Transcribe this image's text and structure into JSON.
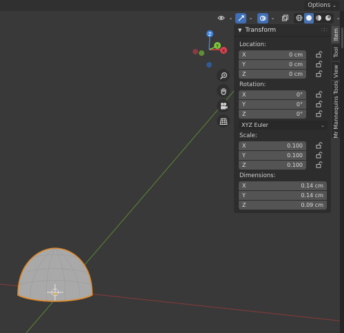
{
  "header": {
    "options_label": "Options",
    "tools": [
      {
        "icon": "visibility-icon"
      },
      {
        "icon": "gizmo-toggle-icon"
      },
      {
        "icon": "overlays-icon"
      },
      {
        "icon": "xray-icon"
      }
    ],
    "shading_modes": [
      {
        "icon": "wireframe-shading-icon",
        "active": false
      },
      {
        "icon": "solid-shading-icon",
        "active": true
      },
      {
        "icon": "material-shading-icon",
        "active": false
      },
      {
        "icon": "rendered-shading-icon",
        "active": false
      }
    ]
  },
  "gizmo": {
    "x": "X",
    "y": "Y",
    "z": "Z",
    "colors": {
      "x": "#e2414f",
      "y": "#80c83b",
      "z": "#3d84e0"
    }
  },
  "nav_buttons": [
    {
      "icon": "zoom-icon"
    },
    {
      "icon": "pan-hand-icon"
    },
    {
      "icon": "camera-view-icon"
    },
    {
      "icon": "ortho-grid-icon"
    }
  ],
  "transform_panel": {
    "title": "Transform",
    "location": {
      "label": "Location:",
      "rows": [
        {
          "axis": "X",
          "value": "0 cm"
        },
        {
          "axis": "Y",
          "value": "0 cm"
        },
        {
          "axis": "Z",
          "value": "0 cm"
        }
      ]
    },
    "rotation": {
      "label": "Rotation:",
      "rows": [
        {
          "axis": "X",
          "value": "0°"
        },
        {
          "axis": "Y",
          "value": "0°"
        },
        {
          "axis": "Z",
          "value": "0°"
        }
      ],
      "mode": "XYZ Euler"
    },
    "scale": {
      "label": "Scale:",
      "rows": [
        {
          "axis": "X",
          "value": "0.100"
        },
        {
          "axis": "Y",
          "value": "0.100"
        },
        {
          "axis": "Z",
          "value": "0.100"
        }
      ]
    },
    "dimensions": {
      "label": "Dimensions:",
      "rows": [
        {
          "axis": "X",
          "value": "0.14 cm"
        },
        {
          "axis": "Y",
          "value": "0.14 cm"
        },
        {
          "axis": "Z",
          "value": "0.09 cm"
        }
      ]
    }
  },
  "sidebar_tabs": [
    {
      "label": "Item",
      "active": true
    },
    {
      "label": "Tool",
      "active": false
    },
    {
      "label": "View",
      "active": false
    },
    {
      "label": "Mr Mannequins Tools",
      "active": false
    }
  ],
  "colors": {
    "viewport_bg": "#393939",
    "axis_x_line": "#8a3a3a",
    "axis_y_line": "#5e8a34",
    "selection_outline": "#e08a2a",
    "accent_blue": "#4772b3"
  }
}
